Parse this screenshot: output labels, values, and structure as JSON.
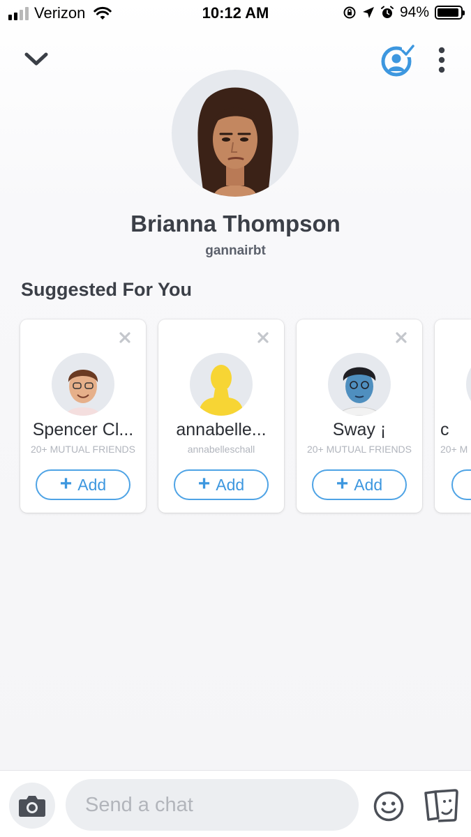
{
  "status_bar": {
    "carrier": "Verizon",
    "time": "10:12 AM",
    "battery_percent": "94%",
    "battery_level": 0.94,
    "icons": [
      "signal-icon",
      "wifi-icon",
      "orientation-lock-icon",
      "location-arrow-icon",
      "alarm-icon",
      "battery-icon"
    ]
  },
  "header": {
    "icons": [
      "chevron-down-icon",
      "bitmoji-check-icon",
      "more-vertical-icon"
    ]
  },
  "profile": {
    "display_name": "Brianna Thompson",
    "username": "gannairbt"
  },
  "suggested": {
    "title": "Suggested For You",
    "cards": [
      {
        "name": "Spencer Cl...",
        "subtitle": "20+ MUTUAL FRIENDS",
        "add_label": "Add"
      },
      {
        "name": "annabelle...",
        "subtitle": "annabelleschall",
        "add_label": "Add"
      },
      {
        "name": "Sway ¡",
        "subtitle": "20+ MUTUAL FRIENDS",
        "add_label": "Add"
      },
      {
        "name": "c",
        "subtitle": "20+ M",
        "add_label": ""
      }
    ]
  },
  "chat_bar": {
    "placeholder": "Send a chat",
    "icons": [
      "camera-icon",
      "emoji-icon",
      "cards-icon"
    ]
  },
  "colors": {
    "accent": "#3d97df",
    "text_dark": "#3b3f47",
    "muted": "#b1b5bd"
  }
}
